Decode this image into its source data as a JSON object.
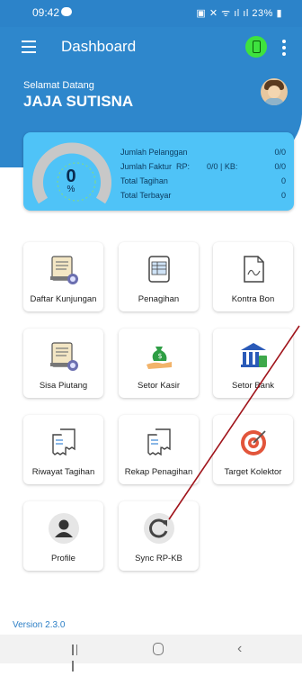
{
  "status_bar": {
    "time": "09:42",
    "battery": "23%"
  },
  "app_bar": {
    "title": "Dashboard"
  },
  "welcome": {
    "greeting": "Selamat Datang",
    "name": "JAJA SUTISNA"
  },
  "summary": {
    "progress_value": "0",
    "progress_unit": "%",
    "rows": [
      {
        "label": "Jumlah Pelanggan",
        "mid": "",
        "value": "0/0"
      },
      {
        "label": "Jumlah Faktur  RP:",
        "mid": "0/0 | KB:",
        "value": "0/0"
      },
      {
        "label": "Total Tagihan",
        "mid": "",
        "value": "0"
      },
      {
        "label": "Total Terbayar",
        "mid": "",
        "value": "0"
      }
    ]
  },
  "menu": [
    {
      "label": "Daftar Kunjungan",
      "icon": "ledger-clock-icon"
    },
    {
      "label": "Penagihan",
      "icon": "invoice-icon"
    },
    {
      "label": "Kontra Bon",
      "icon": "contract-document-icon"
    },
    {
      "label": "Sisa Piutang",
      "icon": "ledger-clock-icon"
    },
    {
      "label": "Setor Kasir",
      "icon": "money-bag-hand-icon"
    },
    {
      "label": "Setor Bank",
      "icon": "bank-icon"
    },
    {
      "label": "Riwayat Tagihan",
      "icon": "receipts-icon"
    },
    {
      "label": "Rekap Penagihan",
      "icon": "receipts-icon"
    },
    {
      "label": "Target Kolektor",
      "icon": "target-icon"
    },
    {
      "label": "Profile",
      "icon": "person-icon"
    },
    {
      "label": "Sync RP-KB",
      "icon": "refresh-icon"
    }
  ],
  "version": "Version 2.3.0",
  "colors": {
    "primary": "#2e87cc",
    "summary_bg": "#4fc3f7",
    "version_text": "#2c7fc6",
    "annotation": "#a0141b"
  }
}
